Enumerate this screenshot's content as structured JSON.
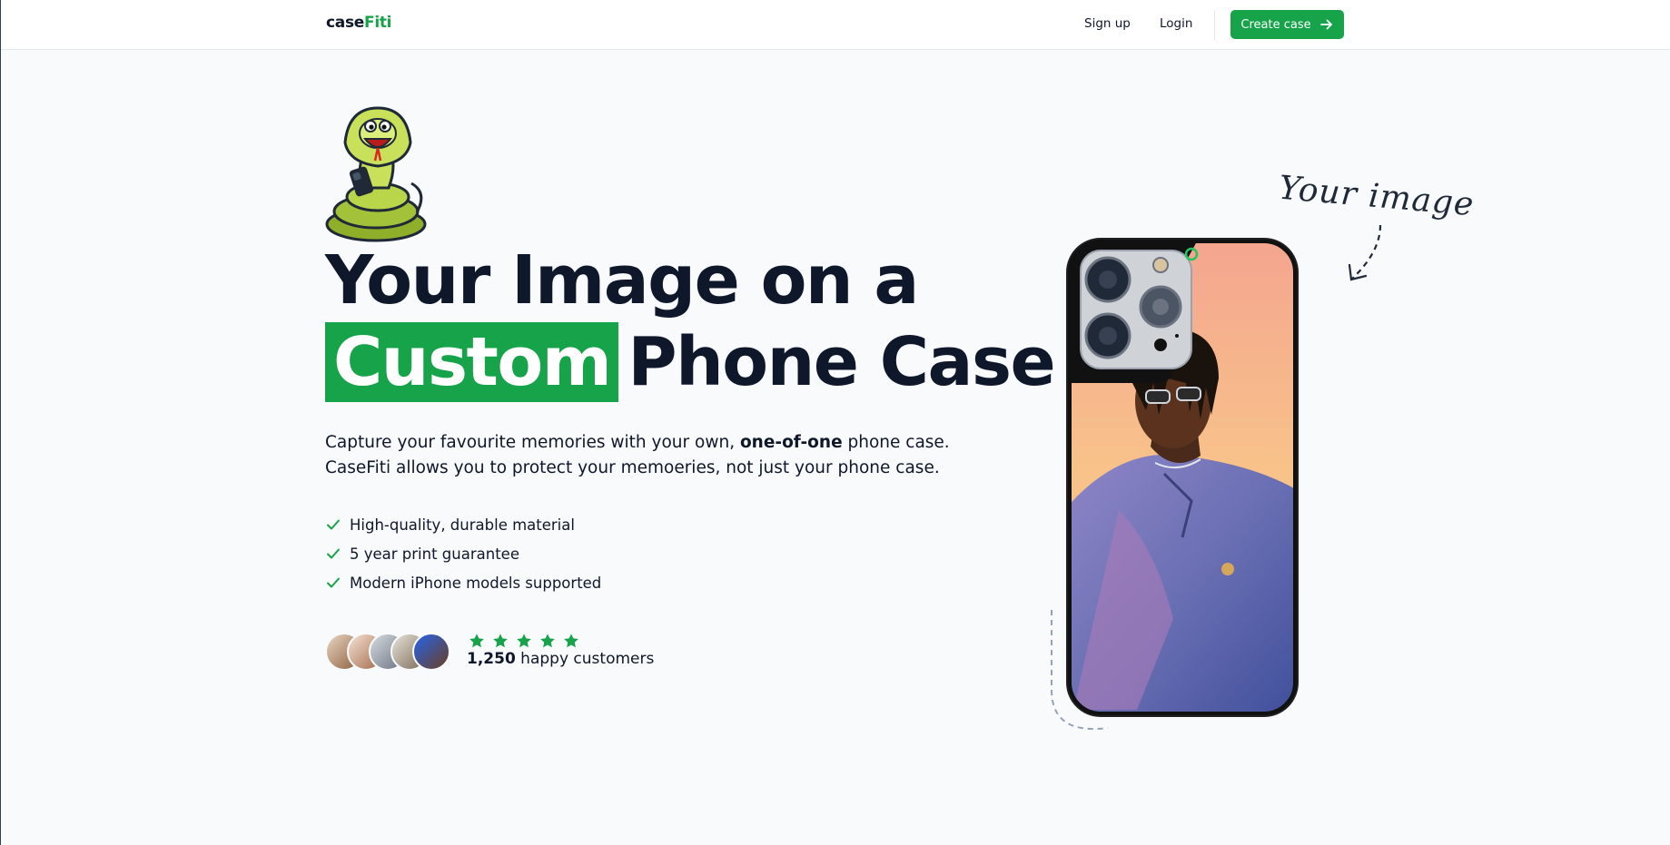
{
  "brand": {
    "name_part1": "case",
    "name_part2": "Fiti",
    "accent": "#16a34a"
  },
  "nav": {
    "signup": "Sign up",
    "login": "Login",
    "cta": "Create case"
  },
  "hero": {
    "line1": "Your Image on a",
    "highlight": "Custom",
    "line2_rest": "Phone Case",
    "desc_part1": "Capture your favourite memories with your own, ",
    "desc_bold": "one-of-one",
    "desc_part2": " phone case.",
    "desc_line2": "CaseFiti allows you to protect your memoeries, not just your phone case.",
    "features": [
      "High-quality, durable material",
      "5 year print guarantee",
      "Modern iPhone models supported"
    ]
  },
  "social": {
    "count": "1,250",
    "label": " happy customers",
    "stars": 5
  },
  "annotation": {
    "your_image": "Your image"
  },
  "icons": [
    "snake-mascot-icon",
    "arrow-right-icon",
    "check-icon",
    "star-icon",
    "phone-case-image"
  ]
}
